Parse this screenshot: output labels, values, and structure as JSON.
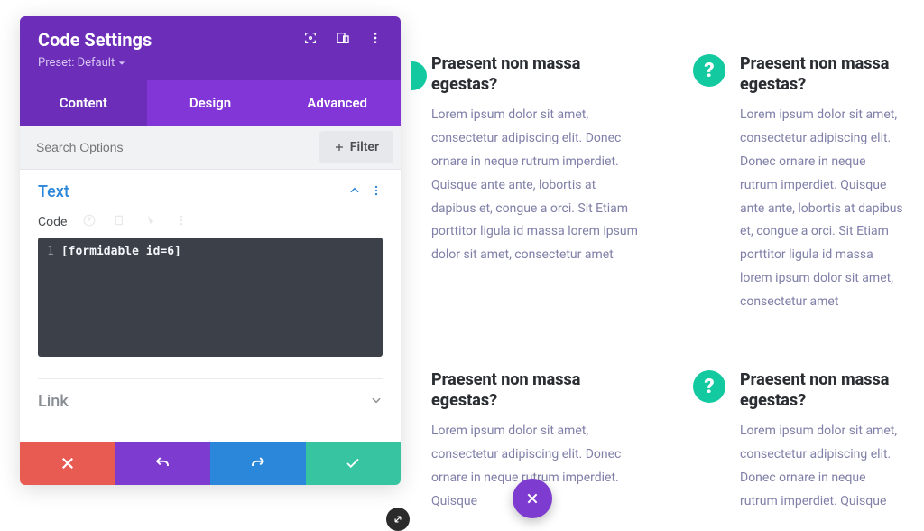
{
  "panel": {
    "title": "Code Settings",
    "preset_label": "Preset: Default"
  },
  "tabs": {
    "content": "Content",
    "design": "Design",
    "advanced": "Advanced"
  },
  "search": {
    "placeholder": "Search Options"
  },
  "filter": {
    "label": "Filter"
  },
  "sections": {
    "text": {
      "title": "Text"
    },
    "link": {
      "title": "Link"
    }
  },
  "code_field": {
    "label": "Code",
    "line_num": "1",
    "content": "[formidable id=6]"
  },
  "faq": [
    {
      "title": "Praesent non massa egestas?",
      "body": "Lorem ipsum dolor sit amet, consectetur adipiscing elit. Donec ornare in neque rutrum imperdiet. Quisque ante ante, lobortis at dapibus et, congue a orci. Sit Etiam porttitor ligula id massa lorem ipsum dolor sit amet, consectetur amet"
    },
    {
      "title": "Praesent non massa egestas?",
      "body": "Lorem ipsum dolor sit amet, consectetur adipiscing elit. Donec ornare in neque rutrum imperdiet. Quisque ante ante, lobortis at dapibus et, congue a orci. Sit Etiam porttitor ligula id massa lorem ipsum dolor sit amet, consectetur amet"
    },
    {
      "title": "Praesent non massa egestas?",
      "body": "Lorem ipsum dolor sit amet, consectetur adipiscing elit. Donec ornare in neque rutrum imperdiet. Quisque"
    },
    {
      "title": "Praesent non massa egestas?",
      "body": "Lorem ipsum dolor sit amet, consectetur adipiscing elit. Donec ornare in neque rutrum imperdiet. Quisque"
    }
  ],
  "q_mark": "?",
  "colors": {
    "purple_dark": "#6c2eb9",
    "purple": "#8236d8",
    "purple_btn": "#7e3bd0",
    "blue": "#2b87da",
    "teal": "#12c9a0",
    "green_btn": "#37c4a1",
    "red": "#e85b53"
  }
}
